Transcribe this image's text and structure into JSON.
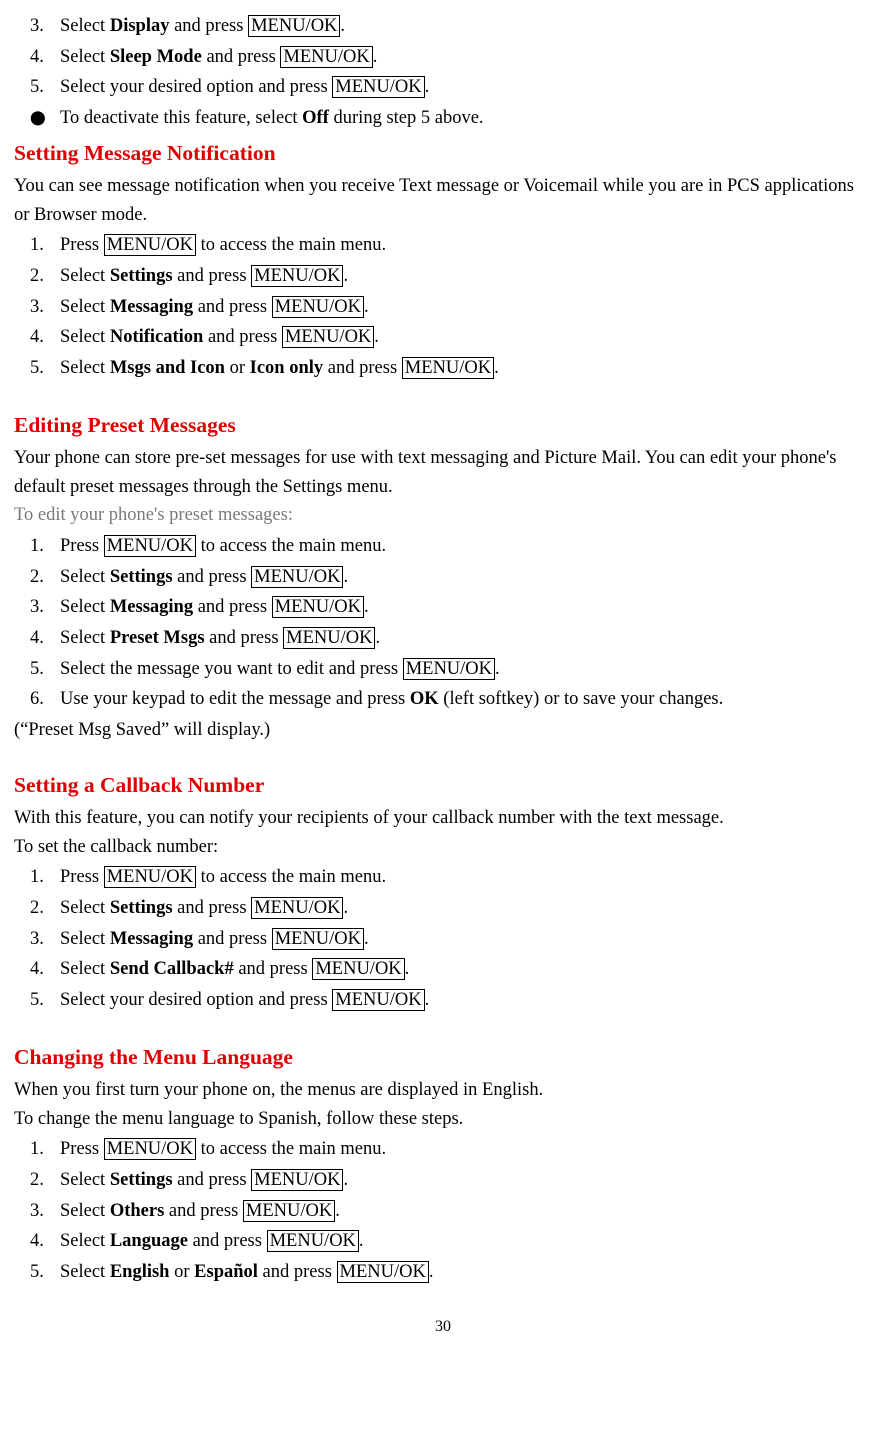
{
  "btn": "MENU/OK",
  "s1": {
    "n3_a": "Select ",
    "n3_b": "Display",
    "n3_c": " and press ",
    "n3_d": ".",
    "n4_a": "Select ",
    "n4_b": "Sleep Mode",
    "n4_c": " and press ",
    "n4_d": ".",
    "n5_a": "Select your desired option and press ",
    "n5_b": ".",
    "bul_a": "To deactivate this feature, select ",
    "bul_b": "Off",
    "bul_c": " during step 5 above."
  },
  "h2": "Setting Message Notification",
  "s2": {
    "intro": "You can see message notification when you receive Text message or Voicemail while you are in PCS applications or Browser mode.",
    "n1_a": "Press ",
    "n1_b": " to access the main menu.",
    "n2_a": "Select ",
    "n2_b": "Settings",
    "n2_c": " and press ",
    "n2_d": ".",
    "n3_a": "Select ",
    "n3_b": "Messaging",
    "n3_c": " and press ",
    "n3_d": ".",
    "n4_a": "Select ",
    "n4_b": "Notification",
    "n4_c": " and press ",
    "n4_d": ".",
    "n5_a": "Select ",
    "n5_b": "Msgs and Icon",
    "n5_c": " or ",
    "n5_d": "Icon only",
    "n5_e": " and press ",
    "n5_f": "."
  },
  "h3": "Editing Preset Messages",
  "s3": {
    "intro": "Your phone can store pre-set messages for use with text messaging and Picture Mail. You can edit your phone's default preset messages through the Settings menu.",
    "sub": "To edit your phone's preset messages:",
    "n1_a": "Press ",
    "n1_b": " to access the main menu.",
    "n2_a": "Select ",
    "n2_b": "Settings",
    "n2_c": " and press ",
    "n2_d": ".",
    "n3_a": "Select ",
    "n3_b": "Messaging",
    "n3_c": " and press ",
    "n3_d": ".",
    "n4_a": "Select ",
    "n4_b": "Preset Msgs",
    "n4_c": " and press ",
    "n4_d": ".",
    "n5_a": "Select the message you want to edit and press ",
    "n5_b": ".",
    "n6_a": "Use your keypad to edit the message and press ",
    "n6_b": "OK",
    "n6_c": " (left softkey) or to save your changes.",
    "tail": "(“Preset Msg Saved” will display.)"
  },
  "h4": "Setting a Callback Number",
  "s4": {
    "intro": "With this feature, you can notify your recipients of your callback number with the text message.",
    "sub": "To set the callback number:",
    "n1_a": "Press ",
    "n1_b": " to access the main menu.",
    "n2_a": "Select ",
    "n2_b": "Settings",
    "n2_c": " and press ",
    "n2_d": ".",
    "n3_a": "Select ",
    "n3_b": "Messaging",
    "n3_c": " and press ",
    "n3_d": ".",
    "n4_a": "Select ",
    "n4_b": "Send Callback#",
    "n4_c": " and press ",
    "n4_d": ".",
    "n5_a": "Select your desired option and press ",
    "n5_b": "."
  },
  "h5": "Changing the Menu Language",
  "s5": {
    "intro": "When you first turn your phone on, the menus are displayed in English.",
    "sub": "To change the menu language to Spanish, follow these steps.",
    "n1_a": "Press ",
    "n1_b": " to access the main menu.",
    "n2_a": "Select ",
    "n2_b": "Settings",
    "n2_c": " and press ",
    "n2_d": ".",
    "n3_a": "Select ",
    "n3_b": "Others",
    "n3_c": " and press ",
    "n3_d": ".",
    "n4_a": "Select ",
    "n4_b": "Language",
    "n4_c": " and press ",
    "n4_d": ".",
    "n5_a": "Select ",
    "n5_b": "English",
    "n5_c": " or ",
    "n5_d": "Español",
    "n5_e": " and press ",
    "n5_f": "."
  },
  "pagenum": "30",
  "nums": {
    "n1": "1.",
    "n2": "2.",
    "n3": "3.",
    "n4": "4.",
    "n5": "5.",
    "n6": "6."
  },
  "bullet": "⬤"
}
